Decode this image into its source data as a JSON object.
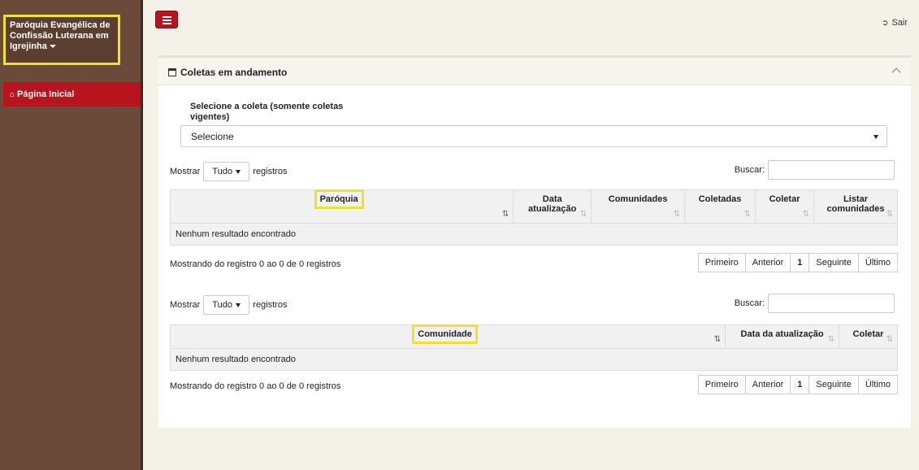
{
  "sidebar": {
    "brand": "Paróquia Evangélica de Confissão Luterana em Igrejinha",
    "items": [
      {
        "label": "Página Inicial",
        "icon": "home-icon"
      }
    ]
  },
  "topbar": {
    "logout_label": "Sair",
    "logout_icon": "sign-out-icon",
    "menu_icon": "hamburger-icon"
  },
  "panel": {
    "title": "Coletas em andamento",
    "select_label": "Selecione a coleta (somente coletas vigentes)",
    "select_value": "Selecione"
  },
  "table1": {
    "show_label": "Mostrar",
    "length_value": "Tudo",
    "records_label": "registros",
    "search_label": "Buscar:",
    "columns": [
      "Paróquia",
      "Data atualização",
      "Comunidades",
      "Coletadas",
      "Coletar",
      "Listar comunidades"
    ],
    "empty_text": "Nenhum resultado encontrado",
    "info": "Mostrando do registro 0 ao 0 de 0 registros",
    "pager": [
      "Primeiro",
      "Anterior",
      "1",
      "Seguinte",
      "Último"
    ]
  },
  "table2": {
    "show_label": "Mostrar",
    "length_value": "Tudo",
    "records_label": "registros",
    "search_label": "Buscar:",
    "columns": [
      "Comunidade",
      "Data da atualização",
      "Coletar"
    ],
    "empty_text": "Nenhum resultado encontrado",
    "info": "Mostrando do registro 0 ao 0 de 0 registros",
    "pager": [
      "Primeiro",
      "Anterior",
      "1",
      "Seguinte",
      "Último"
    ]
  },
  "colors": {
    "sidebar": "#6b4a3a",
    "accent": "#b8141e",
    "highlight": "#f0e030",
    "background": "#f4f1e8"
  }
}
